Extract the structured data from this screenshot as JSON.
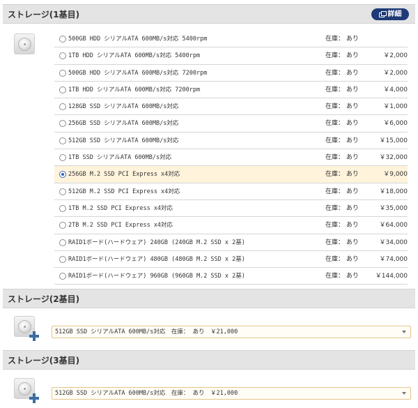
{
  "sections": [
    {
      "title": "ストレージ(1基目)",
      "detail_label": "詳細",
      "options": [
        {
          "name": "500GB HDD シリアルATA 600MB/s対応 5400rpm",
          "stock": "在庫： あり",
          "price": "",
          "selected": false
        },
        {
          "name": "1TB HDD シリアルATA 600MB/s対応 5400rpm",
          "stock": "在庫： あり",
          "price": "￥2,000",
          "selected": false
        },
        {
          "name": "500GB HDD シリアルATA 600MB/s対応 7200rpm",
          "stock": "在庫： あり",
          "price": "￥2,000",
          "selected": false
        },
        {
          "name": "1TB HDD シリアルATA 600MB/s対応 7200rpm",
          "stock": "在庫： あり",
          "price": "￥4,000",
          "selected": false
        },
        {
          "name": "128GB SSD シリアルATA 600MB/s対応",
          "stock": "在庫： あり",
          "price": "￥1,000",
          "selected": false
        },
        {
          "name": "256GB SSD シリアルATA 600MB/s対応",
          "stock": "在庫： あり",
          "price": "￥6,000",
          "selected": false
        },
        {
          "name": "512GB SSD シリアルATA 600MB/s対応",
          "stock": "在庫： あり",
          "price": "￥15,000",
          "selected": false
        },
        {
          "name": "1TB SSD シリアルATA 600MB/s対応",
          "stock": "在庫： あり",
          "price": "￥32,000",
          "selected": false
        },
        {
          "name": "256GB M.2 SSD PCI Express x4対応",
          "stock": "在庫： あり",
          "price": "￥9,000",
          "selected": true
        },
        {
          "name": "512GB M.2 SSD PCI Express x4対応",
          "stock": "在庫： あり",
          "price": "￥18,000",
          "selected": false
        },
        {
          "name": "1TB M.2 SSD PCI Express x4対応",
          "stock": "在庫： あり",
          "price": "￥35,000",
          "selected": false
        },
        {
          "name": "2TB M.2 SSD PCI Express x4対応",
          "stock": "在庫： あり",
          "price": "￥64,000",
          "selected": false
        },
        {
          "name": "RAID1ボード(ハードウェア) 240GB (240GB M.2 SSD x 2基)",
          "stock": "在庫： あり",
          "price": "￥34,000",
          "selected": false
        },
        {
          "name": "RAID1ボード(ハードウェア) 480GB (480GB M.2 SSD x 2基)",
          "stock": "在庫： あり",
          "price": "￥74,000",
          "selected": false
        },
        {
          "name": "RAID1ボード(ハードウェア) 960GB (960GB M.2 SSD x 2基)",
          "stock": "在庫： あり",
          "price": "￥144,000",
          "selected": false
        }
      ]
    },
    {
      "title": "ストレージ(2基目)",
      "select_value": "512GB SSD シリアルATA 600MB/s対応　在庫： あり　￥21,000"
    },
    {
      "title": "ストレージ(3基目)",
      "select_value": "512GB SSD シリアルATA 600MB/s対応　在庫： あり　￥21,000"
    }
  ],
  "icons": {
    "detail": "detail-window-icon",
    "drive": "drive-icon",
    "add": "add-plus-icon",
    "dropdown": "chevron-down-icon"
  },
  "colors": {
    "header_bg": "#e4e4e4",
    "detail_button": "#1f3a77",
    "selected_row": "#fff3dc",
    "select_border": "#e6c48e",
    "add_badge": "#3b6ea5"
  }
}
